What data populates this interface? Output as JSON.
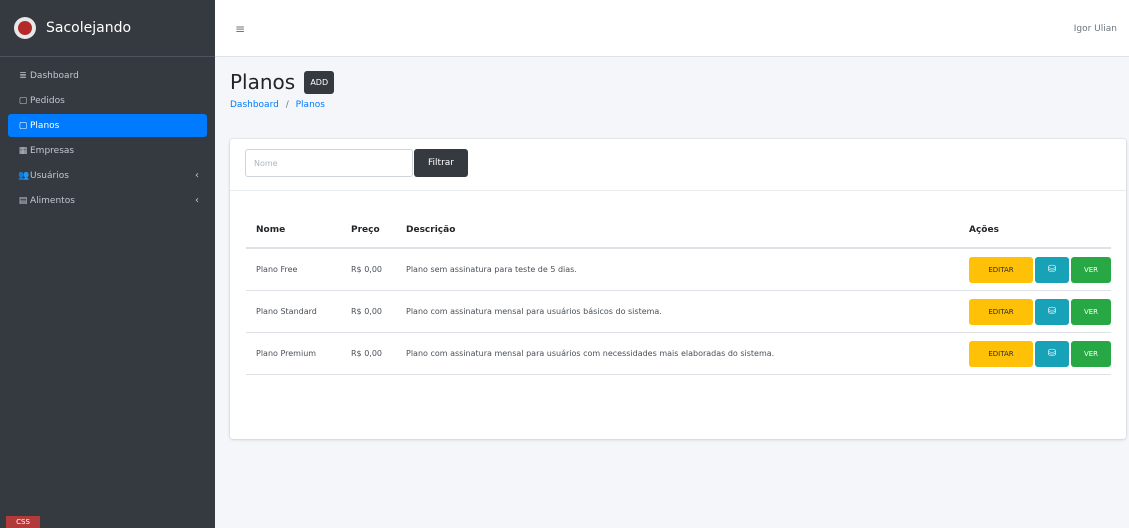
{
  "brand": {
    "name": "Sacolejando"
  },
  "sidebar": {
    "items": [
      {
        "label": "Dashboard",
        "icon": "≣"
      },
      {
        "label": "Pedidos",
        "icon": "▢"
      },
      {
        "label": "Planos",
        "icon": "▢"
      },
      {
        "label": "Empresas",
        "icon": "▦"
      },
      {
        "label": "Usuários",
        "icon": "👥"
      },
      {
        "label": "Alimentos",
        "icon": "▤"
      }
    ],
    "footer": "CSS"
  },
  "topbar": {
    "menu_icon": "≡",
    "user_name": "Igor Ulian"
  },
  "header": {
    "title": "Planos",
    "add_label": "ADD",
    "breadcrumb": {
      "home": "Dashboard",
      "separator": "/",
      "current": "Planos"
    }
  },
  "filter": {
    "placeholder": "Nome",
    "value": "",
    "button_label": "Filtrar"
  },
  "table": {
    "columns": [
      "Nome",
      "Preço",
      "Descrição",
      "Ações"
    ],
    "rows": [
      {
        "nome": "Plano Free",
        "preco": "R$ 0,00",
        "descricao": "Plano sem assinatura para teste de 5 dias."
      },
      {
        "nome": "Plano Standard",
        "preco": "R$ 0,00",
        "descricao": "Plano com assinatura mensal para usuários básicos do sistema."
      },
      {
        "nome": "Plano Premium",
        "preco": "R$ 0,00",
        "descricao": "Plano com assinatura mensal para usuários com necessidades mais elaboradas do sistema."
      }
    ],
    "actions": {
      "edit_label": "EDITAR",
      "db_icon": "⛁",
      "view_label": "VER"
    }
  }
}
